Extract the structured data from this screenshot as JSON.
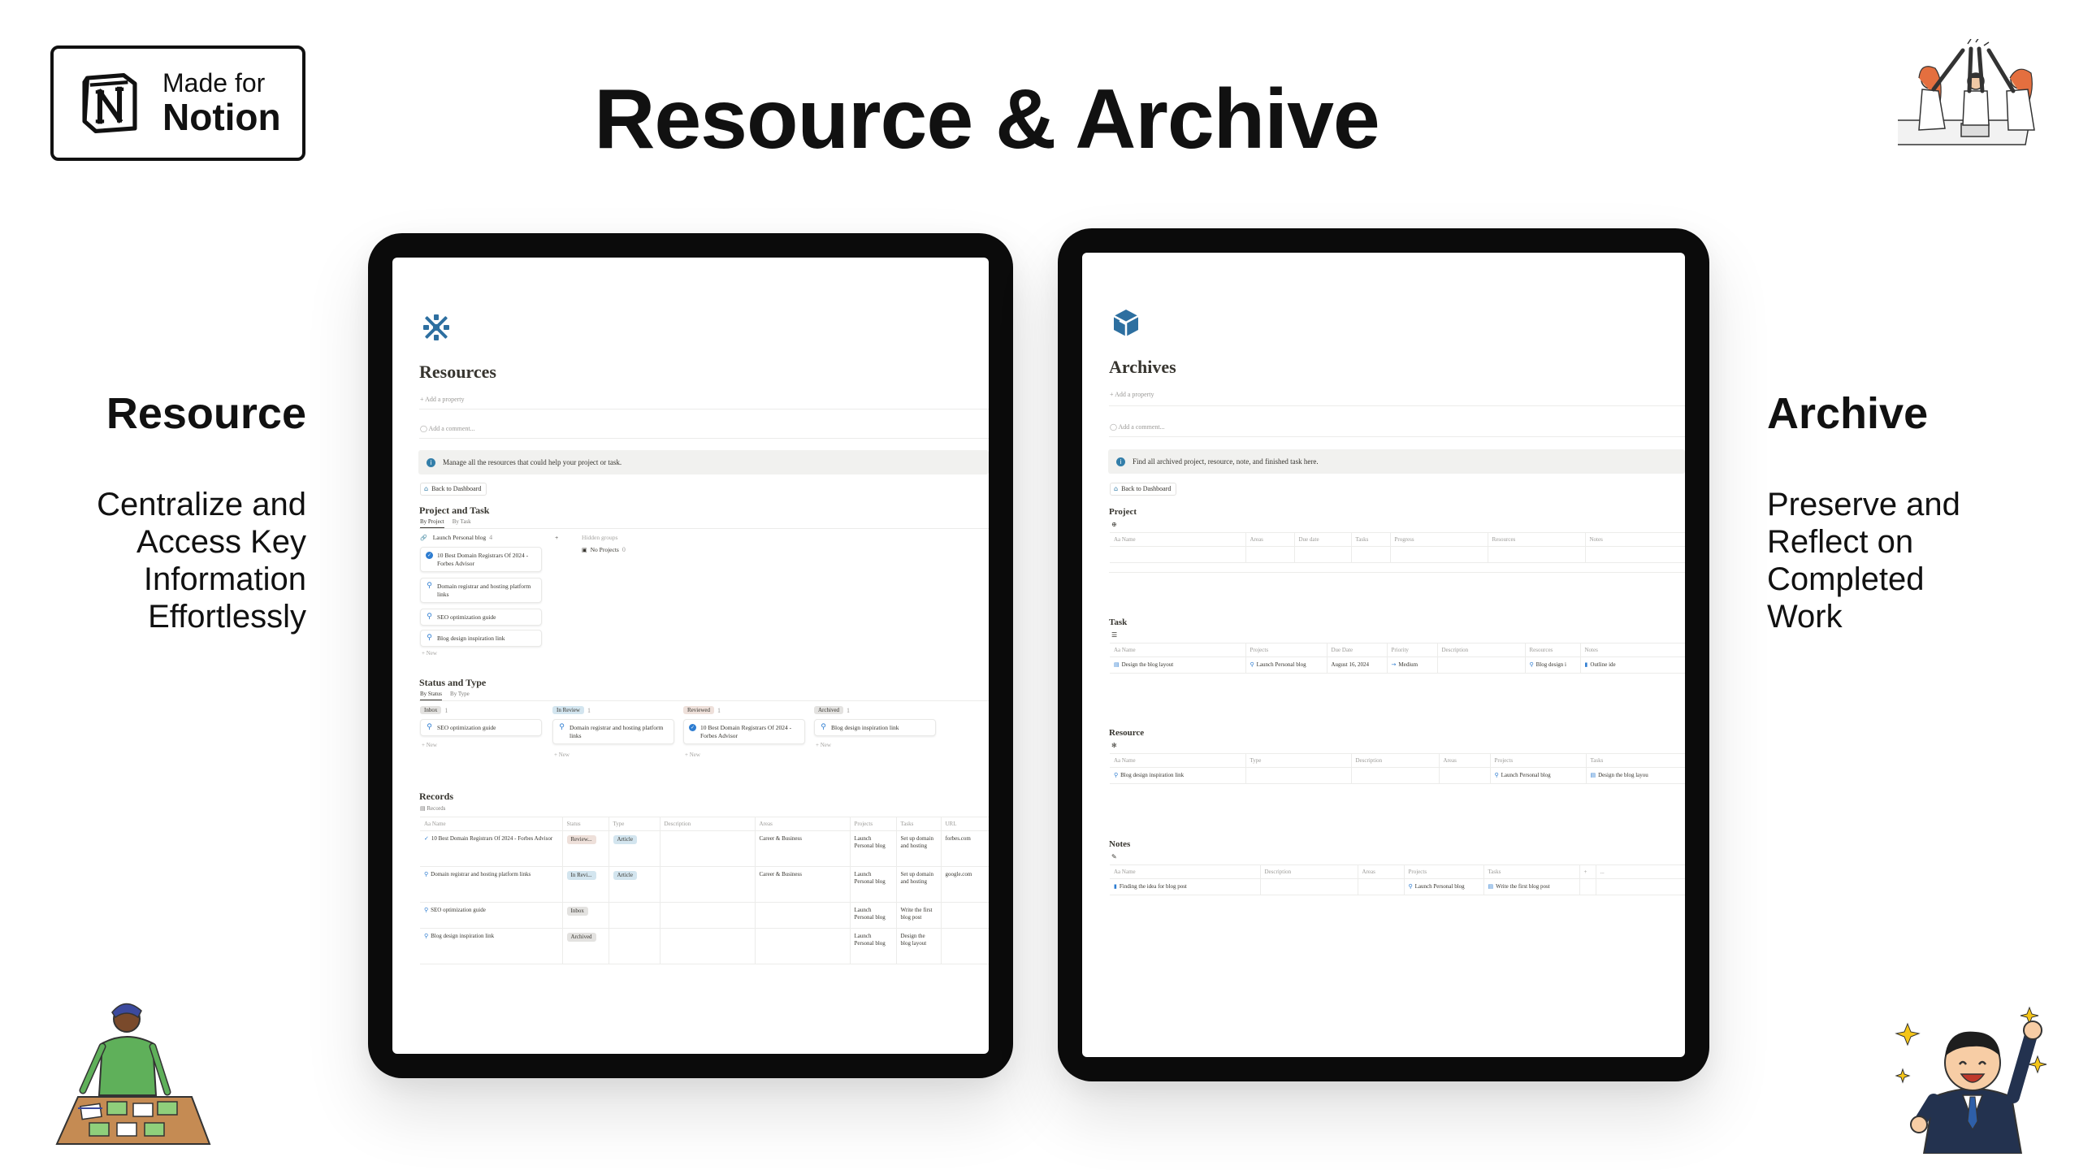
{
  "badge": {
    "line1": "Made for",
    "line2": "Notion"
  },
  "headline": "Resource & Archive",
  "left_caption": {
    "title": "Resource",
    "body": "Centralize and Access Key Information Effortlessly"
  },
  "right_caption": {
    "title": "Archive",
    "body": "Preserve and Reflect on Completed Work"
  },
  "resources_page": {
    "title": "Resources",
    "add_property": "Add a property",
    "add_comment": "Add a comment...",
    "callout": "Manage all the resources that could help your project or task.",
    "back_button": "Back to Dashboard",
    "section_project_task": "Project and Task",
    "tabs_project": [
      "By Project",
      "By Task"
    ],
    "group_label": "Launch Personal blog",
    "group_count": "4",
    "hidden_groups": "Hidden groups",
    "no_projects": "No Projects",
    "no_projects_count": "0",
    "project_cards": [
      "10 Best Domain Registrars Of 2024 - Forbes Advisor",
      "Domain registrar and hosting platform links",
      "SEO optimization guide",
      "Blog design inspiration link"
    ],
    "new_label": "+ New",
    "section_status_type": "Status and Type",
    "tabs_status": [
      "By Status",
      "By Type"
    ],
    "status_columns": [
      {
        "label": "Inbox",
        "count": "1",
        "card": "SEO optimization guide"
      },
      {
        "label": "In Review",
        "count": "1",
        "card": "Domain registrar and hosting platform links"
      },
      {
        "label": "Reviewed",
        "count": "1",
        "card": "10 Best Domain Registrars Of 2024 - Forbes Advisor"
      },
      {
        "label": "Archived",
        "count": "1",
        "card": "Blog design inspiration link"
      }
    ],
    "section_records": "Records",
    "records_view": "Records",
    "records_headers": [
      "Aa Name",
      "Status",
      "Type",
      "Description",
      "Areas",
      "Projects",
      "Tasks",
      "URL"
    ],
    "records_rows": [
      {
        "name": "10 Best Domain Registrars Of 2024 - Forbes Advisor",
        "status": "Review...",
        "type": "Article",
        "description": "",
        "areas": "Career & Business",
        "projects": "Launch Personal blog",
        "tasks": "Set up domain and hosting",
        "url": "forbes.com"
      },
      {
        "name": "Domain registrar and hosting platform links",
        "status": "In Revi...",
        "type": "Article",
        "description": "",
        "areas": "Career & Business",
        "projects": "Launch Personal blog",
        "tasks": "Set up domain and hosting",
        "url": "google.com"
      },
      {
        "name": "SEO optimization guide",
        "status": "Inbox",
        "type": "",
        "description": "",
        "areas": "",
        "projects": "Launch Personal blog",
        "tasks": "Write the first blog post",
        "url": ""
      },
      {
        "name": "Blog design inspiration link",
        "status": "Archived",
        "type": "",
        "description": "",
        "areas": "",
        "projects": "Launch Personal blog",
        "tasks": "Design the blog layout",
        "url": ""
      }
    ]
  },
  "archives_page": {
    "title": "Archives",
    "add_property": "Add a property",
    "add_comment": "Add a comment...",
    "callout": "Find all archived project, resource, note, and finished task here.",
    "back_button": "Back to Dashboard",
    "project": {
      "title": "Project",
      "headers": [
        "Aa Name",
        "Areas",
        "Due date",
        "Tasks",
        "Progress",
        "Resources",
        "Notes"
      ]
    },
    "task": {
      "title": "Task",
      "headers": [
        "Aa Name",
        "Projects",
        "Due Date",
        "Priority",
        "Description",
        "Resources",
        "Notes"
      ],
      "row": {
        "name": "Design the blog layout",
        "projects": "Launch Personal blog",
        "due": "August 16, 2024",
        "priority": "Medium",
        "description": "",
        "resources": "Blog design i",
        "notes": "Outline ide"
      }
    },
    "resource": {
      "title": "Resource",
      "headers": [
        "Aa Name",
        "Type",
        "Description",
        "Areas",
        "Projects",
        "Tasks"
      ],
      "row": {
        "name": "Blog design inspiration link",
        "type": "",
        "description": "",
        "areas": "",
        "projects": "Launch Personal blog",
        "tasks": "Design the blog layou"
      }
    },
    "notes": {
      "title": "Notes",
      "headers": [
        "Aa Name",
        "Description",
        "Areas",
        "Projects",
        "Tasks",
        "+",
        "..."
      ],
      "row": {
        "name": "Finding the idea for blog post",
        "description": "",
        "areas": "",
        "projects": "Launch Personal blog",
        "tasks": "Write the first blog post"
      }
    }
  },
  "colors": {
    "notion_blue": "#2e7dd1",
    "callout_bg": "#f1f1ef",
    "tablet_frame": "#0b0b0b"
  },
  "icons": [
    "notion-logo",
    "resources-snowflake-icon",
    "archive-box-icon",
    "house-icon",
    "link-icon",
    "check-circle-icon"
  ]
}
